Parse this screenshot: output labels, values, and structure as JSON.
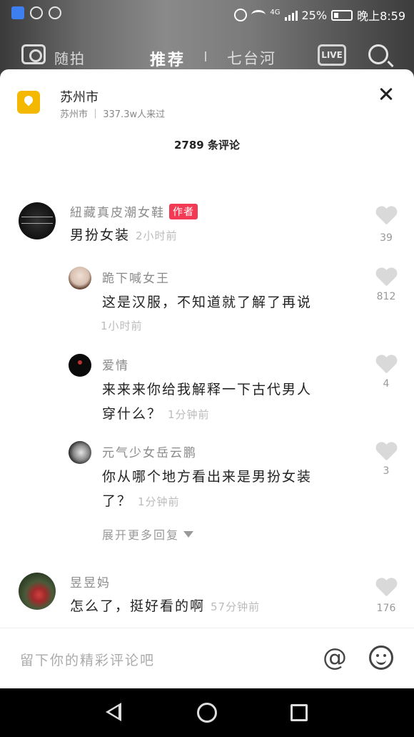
{
  "status_bar": {
    "network": "4G",
    "battery": "25%",
    "time": "晚上8:59"
  },
  "top_nav": {
    "suipai": "随拍",
    "recommend": "推荐",
    "local": "七台河",
    "live": "LIVE"
  },
  "location": {
    "title": "苏州市",
    "subtitle": "苏州市 ｜ 337.3w人来过"
  },
  "comment_count": "2789 条评论",
  "comments": [
    {
      "username": "紐藏真皮潮女鞋",
      "badge": "作者",
      "text": "男扮女装",
      "time": "2小时前",
      "likes": "39",
      "avatar_colors": [
        "#111111",
        "#333333"
      ]
    },
    {
      "username": "跪下喊女王",
      "text": "这是汉服，不知道就了解了再说",
      "time": "1小时前",
      "likes": "812",
      "avatar_colors": [
        "#e8d8cc",
        "#6a4a3a"
      ]
    },
    {
      "username": "爱情",
      "text": "来来来你给我解释一下古代男人穿什么？",
      "text_line1": "来来来你给我解释一下古代男人",
      "text_line2": "穿什么？",
      "time": "1分钟前",
      "likes": "4",
      "avatar_colors": [
        "#0a0a0a",
        "#c03030"
      ]
    },
    {
      "username": "元气少女岳云鹏",
      "text": "你从哪个地方看出来是男扮女装了？",
      "text_line1": "你从哪个地方看出来是男扮女装",
      "text_line2": "了？",
      "time": "1分钟前",
      "likes": "3",
      "avatar_colors": [
        "#d8d8d8",
        "#2a2a2a"
      ]
    },
    {
      "username": "昱昱妈",
      "text": "怎么了，挺好看的啊",
      "time": "57分钟前",
      "likes": "176",
      "avatar_colors": [
        "#3a4a2a",
        "#c23a3a"
      ]
    }
  ],
  "expand_more": "展开更多回复",
  "input_placeholder": "留下你的精彩评论吧",
  "at_symbol": "@",
  "icons": {
    "location": "location-pin-icon",
    "close": "close-icon",
    "like": "heart-icon",
    "mention": "at-icon",
    "emoji": "smile-icon",
    "search": "search-icon",
    "camera": "camera-icon"
  },
  "colors": {
    "author_badge": "#f23a55",
    "location_icon": "#f5b800"
  }
}
